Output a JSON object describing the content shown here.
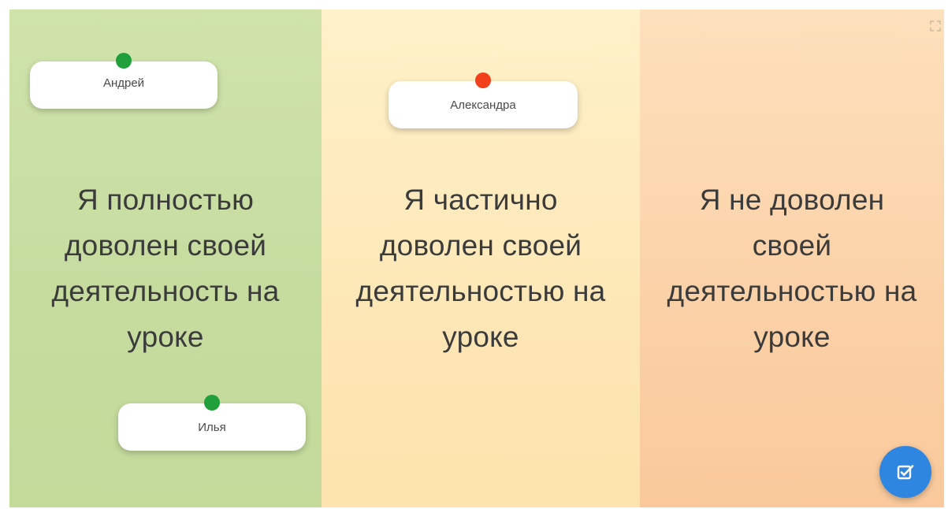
{
  "columns": [
    {
      "text": "Я полностью доволен своей деятельность на уроке",
      "color": "#c6dc9f"
    },
    {
      "text": "Я частично доволен своей деятельностью на уроке",
      "color": "#fde7b6"
    },
    {
      "text": "Я не доволен своей деятельностью на уроке",
      "color": "#fbd1a7"
    }
  ],
  "cards": {
    "andrey": {
      "name": "Андрей",
      "status_color": "#1fa03a"
    },
    "alexandra": {
      "name": "Александра",
      "status_color": "#f2401c"
    },
    "ilya": {
      "name": "Илья",
      "status_color": "#1fa03a"
    }
  },
  "fab": {
    "icon": "edit-checkbox-icon",
    "color": "#2f86e0"
  },
  "corner": {
    "icon": "fullscreen-icon"
  }
}
